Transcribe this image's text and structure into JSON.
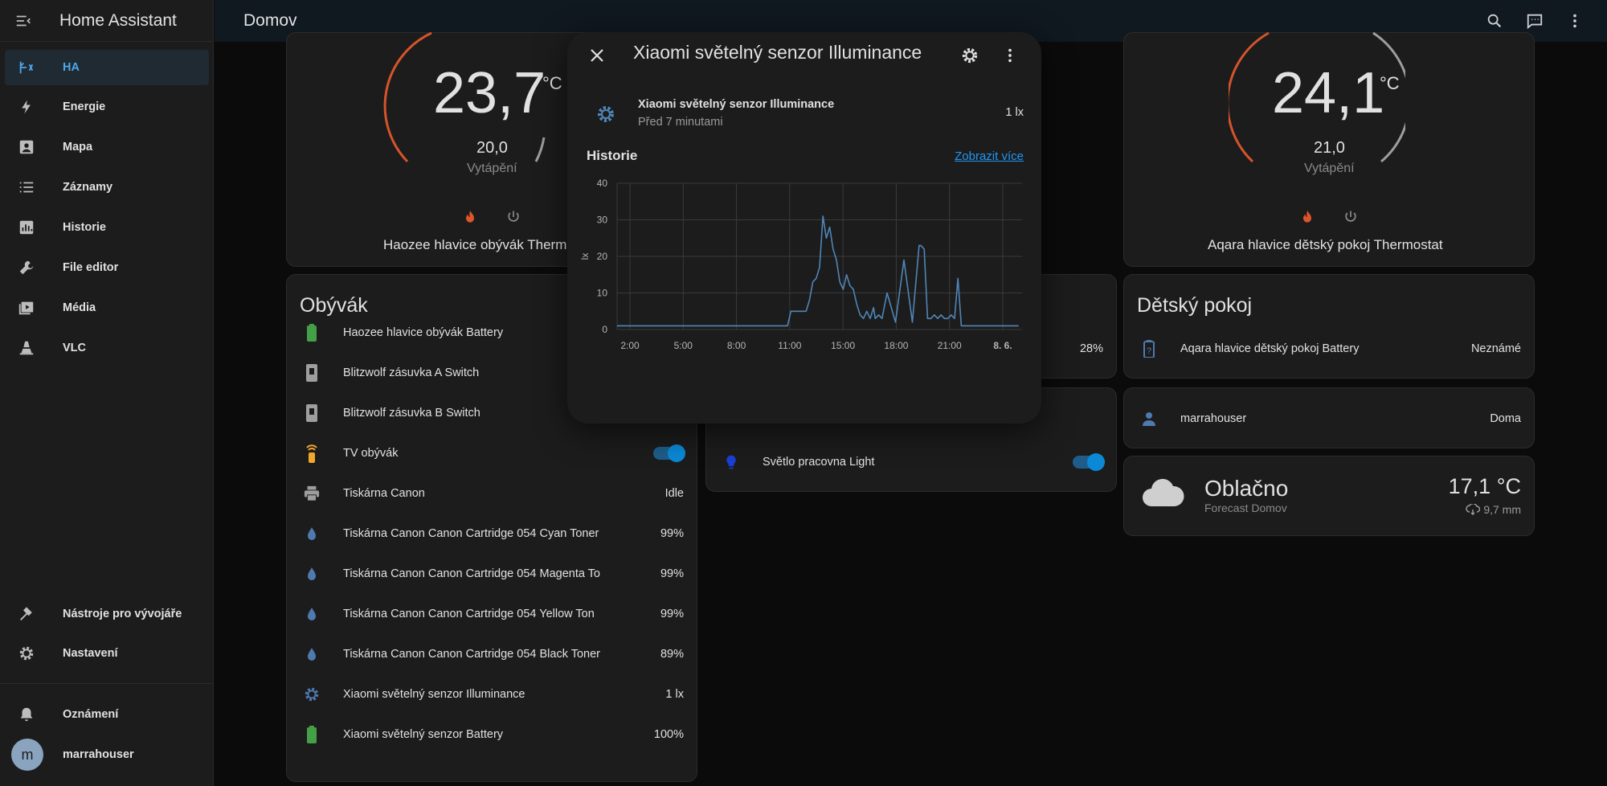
{
  "sidebar": {
    "app_title": "Home Assistant",
    "items": [
      {
        "label": "HA",
        "icon": "ha-logo-icon",
        "active": true
      },
      {
        "label": "Energie",
        "icon": "lightning-icon"
      },
      {
        "label": "Mapa",
        "icon": "map-icon"
      },
      {
        "label": "Záznamy",
        "icon": "logbook-icon"
      },
      {
        "label": "Historie",
        "icon": "history-icon"
      },
      {
        "label": "File editor",
        "icon": "wrench-icon"
      },
      {
        "label": "Média",
        "icon": "media-icon"
      },
      {
        "label": "VLC",
        "icon": "vlc-icon"
      }
    ],
    "dev_tools": "Nástroje pro vývojáře",
    "settings": "Nastavení",
    "notifications": "Oznámení",
    "user": "marrahouser",
    "user_initial": "m"
  },
  "topbar": {
    "title": "Domov"
  },
  "thermostat_left": {
    "temp": "23,7",
    "unit": "°C",
    "target": "20,0",
    "mode": "Vytápění",
    "name": "Haozee hlavice obývák Thermostat"
  },
  "thermostat_right": {
    "temp": "24,1",
    "unit": "°C",
    "target": "21,0",
    "mode": "Vytápění",
    "name": "Aqara hlavice dětský pokoj Thermostat"
  },
  "obyvak": {
    "title": "Obývák",
    "rows": [
      {
        "name": "Haozee hlavice obývák Battery",
        "value": ""
      },
      {
        "name": "Blitzwolf zásuvka A Switch",
        "value": ""
      },
      {
        "name": "Blitzwolf zásuvka B Switch",
        "value": ""
      },
      {
        "name": "TV obývák",
        "value": ""
      },
      {
        "name": "Tiskárna Canon",
        "value": "Idle"
      },
      {
        "name": "Tiskárna Canon Canon Cartridge 054 Cyan Toner",
        "value": "99%"
      },
      {
        "name": "Tiskárna Canon Canon Cartridge 054 Magenta To",
        "value": "99%"
      },
      {
        "name": "Tiskárna Canon Canon Cartridge 054 Yellow Ton",
        "value": "99%"
      },
      {
        "name": "Tiskárna Canon Canon Cartridge 054 Black Toner",
        "value": "89%"
      },
      {
        "name": "Xiaomi světelný senzor Illuminance",
        "value": "1 lx"
      },
      {
        "name": "Xiaomi světelný senzor Battery",
        "value": "100%"
      }
    ]
  },
  "middle": {
    "battery_value": "28%",
    "light_name": "Světlo pracovna Light"
  },
  "detsky": {
    "title": "Dětský pokoj",
    "battery_name": "Aqara hlavice dětský pokoj Battery",
    "battery_value": "Neznámé"
  },
  "person": {
    "name": "marrahouser",
    "state": "Doma"
  },
  "weather": {
    "condition": "Oblačno",
    "subtitle": "Forecast Domov",
    "temp": "17,1 °C",
    "precip": "9,7 mm"
  },
  "dialog": {
    "title": "Xiaomi světelný senzor Illuminance",
    "entity_name": "Xiaomi světelný senzor Illuminance",
    "entity_time": "Před 7 minutami",
    "entity_value": "1 lx",
    "history_label": "Historie",
    "more_link": "Zobrazit více"
  },
  "chart_data": {
    "type": "line",
    "ylabel": "lx",
    "ylim": [
      0,
      40
    ],
    "y_ticks": [
      "0",
      "10",
      "20",
      "30",
      "40"
    ],
    "x_ticks": [
      "2:00",
      "5:00",
      "8:00",
      "11:00",
      "15:00",
      "18:00",
      "21:00",
      "8. 6."
    ],
    "series": [
      {
        "color": "#4f86b8",
        "x": [
          0,
          2.4,
          3.0,
          3.4,
          4.2,
          4.6,
          4.8,
          5.0,
          5.2,
          5.4,
          5.5,
          5.7,
          5.9,
          6.0,
          6.2,
          6.4,
          6.6,
          6.8,
          7.0,
          7.1,
          7.3,
          7.5,
          7.7,
          7.9,
          8.0,
          8.2,
          8.4,
          8.6,
          8.8,
          9.0,
          9.2,
          9.3,
          9.5,
          9.7,
          9.9,
          10.1,
          10.3,
          10.4,
          10.6,
          10.8,
          11.0,
          11.2,
          11.4,
          11.6,
          11.8,
          12.0,
          12.2,
          12.4,
          12.6,
          12.8,
          13.0,
          13.2,
          13.4,
          13.6,
          13.8,
          14.0,
          14.2,
          14.4,
          14.6,
          14.8,
          15.0,
          15.2,
          15.3,
          15.5,
          15.7,
          16.0,
          16.5,
          17.0,
          17.5,
          17.9,
          18.0,
          18.2,
          18.4,
          18.6,
          18.8,
          19.0,
          19.2,
          19.4,
          19.6,
          19.8,
          20.0,
          20.2,
          20.4,
          20.6,
          20.8,
          21.0,
          21.2,
          21.4,
          21.6,
          21.8,
          22.0,
          22.2,
          22.4,
          22.6,
          22.8,
          23.0,
          23.3,
          23.5,
          23.8
        ],
        "y": [
          1,
          1,
          1,
          1,
          1,
          1,
          1,
          1,
          1,
          1,
          1,
          1,
          1,
          1,
          1,
          1,
          1,
          1,
          1,
          1,
          1,
          1,
          1,
          1,
          1,
          1,
          1,
          1,
          1,
          1,
          1,
          1,
          1,
          1,
          1,
          1,
          5,
          5,
          5,
          5,
          5,
          5,
          8,
          13,
          14,
          17,
          31,
          25,
          28,
          22,
          19,
          13,
          11,
          15,
          12,
          11,
          7,
          4,
          3,
          5,
          3,
          6,
          3,
          4,
          3,
          10,
          2,
          19,
          2,
          23,
          23,
          22,
          3,
          3,
          4,
          3,
          4,
          3,
          3,
          4,
          3,
          14,
          1,
          1,
          1,
          1,
          1,
          1,
          1,
          1,
          1,
          1,
          1,
          1,
          1,
          1,
          1,
          1,
          1
        ]
      }
    ]
  }
}
